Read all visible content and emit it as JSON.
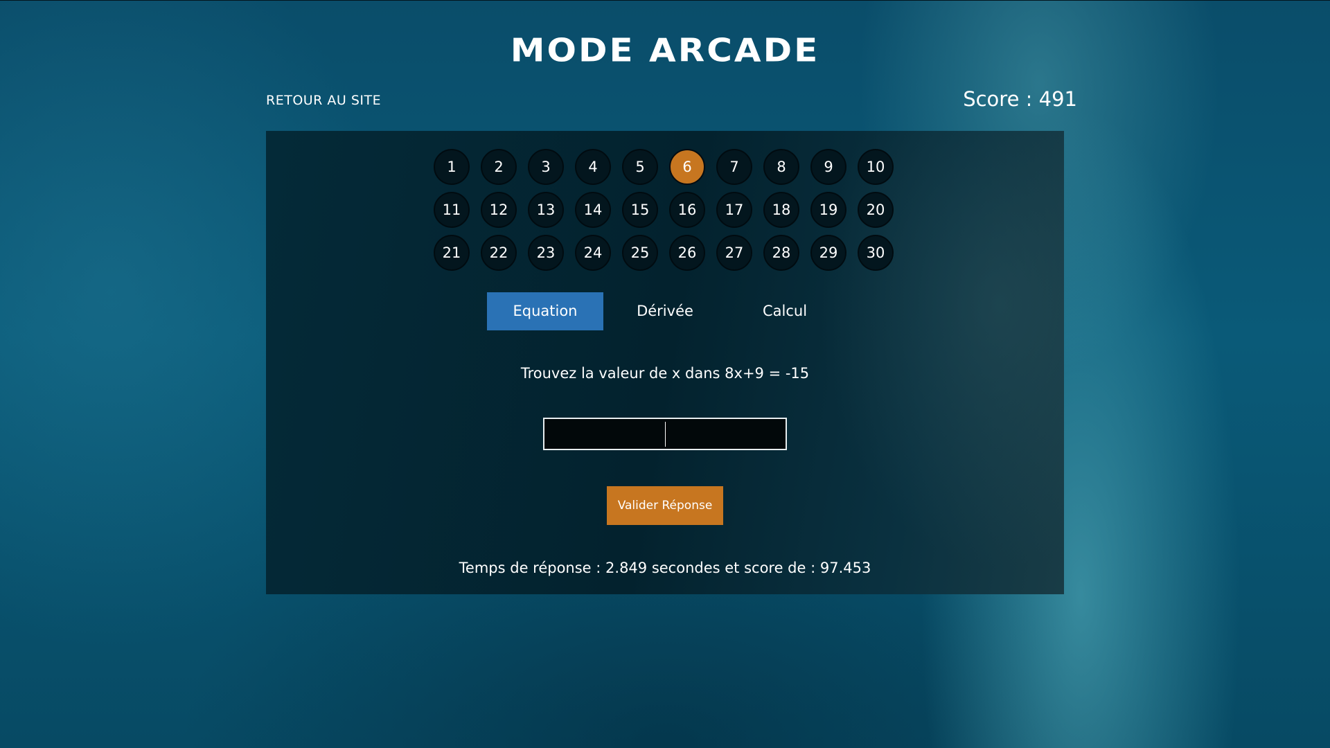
{
  "header": {
    "title": "MODE ARCADE",
    "back_link": "RETOUR AU SITE",
    "score": "Score : 491"
  },
  "levels": {
    "items": [
      "1",
      "2",
      "3",
      "4",
      "5",
      "6",
      "7",
      "8",
      "9",
      "10",
      "11",
      "12",
      "13",
      "14",
      "15",
      "16",
      "17",
      "18",
      "19",
      "20",
      "21",
      "22",
      "23",
      "24",
      "25",
      "26",
      "27",
      "28",
      "29",
      "30"
    ],
    "selected": "6"
  },
  "tabs": [
    {
      "label": "Equation",
      "active": true
    },
    {
      "label": "Dérivée",
      "active": false
    },
    {
      "label": "Calcul",
      "active": false
    }
  ],
  "question": "Trouvez la valeur de x dans 8x+9 = -15",
  "answer": {
    "value": "",
    "placeholder": ""
  },
  "submit_label": "Valider Réponse",
  "result": "Temps de réponse : 2.849 secondes et score de : 97.453",
  "colors": {
    "accent": "#c77620",
    "tab_active": "#2a72b5",
    "panel": "#03222e"
  }
}
